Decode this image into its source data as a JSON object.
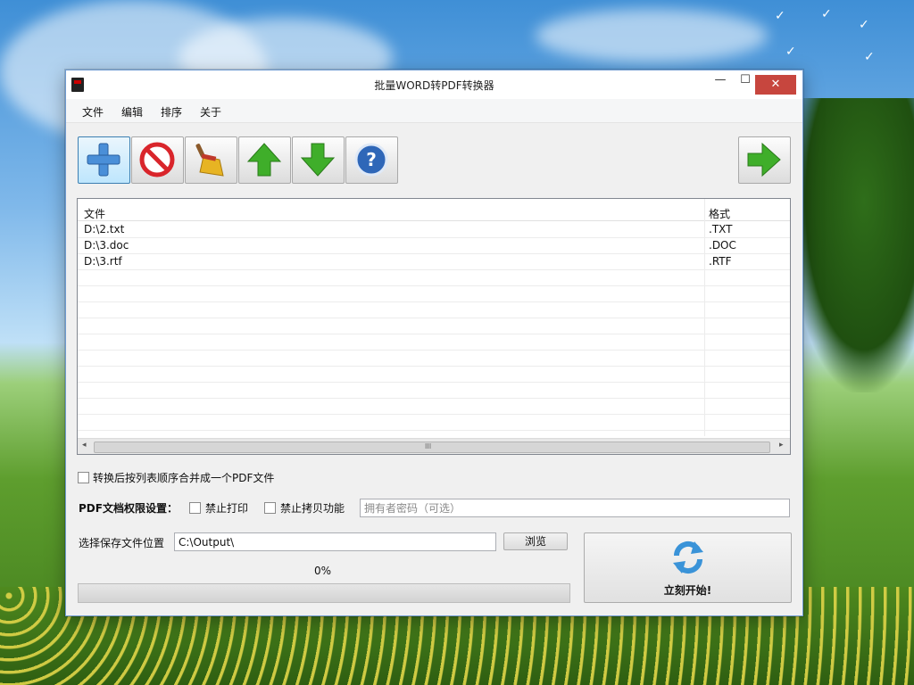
{
  "window": {
    "title": "批量WORD转PDF转换器",
    "controls": {
      "minimize": "—",
      "maximize": "☐",
      "close": "✕"
    }
  },
  "menu": [
    "文件",
    "编辑",
    "排序",
    "关于"
  ],
  "toolbar": {
    "buttons": [
      {
        "icon": "plus-icon"
      },
      {
        "icon": "stop-icon"
      },
      {
        "icon": "broom-icon"
      },
      {
        "icon": "arrow-up-icon"
      },
      {
        "icon": "arrow-down-icon"
      },
      {
        "icon": "help-icon"
      },
      {
        "icon": "arrow-right-icon"
      }
    ],
    "colors": {
      "plus": "#4a8fd8",
      "stop": "#d9252b",
      "green": "#3fae2a",
      "help": "#2f67b8"
    }
  },
  "file_list": {
    "columns": [
      "文件",
      "格式"
    ],
    "rows": [
      {
        "file": "D:\\2.txt",
        "format": ".TXT"
      },
      {
        "file": "D:\\3.doc",
        "format": ".DOC"
      },
      {
        "file": "D:\\3.rtf",
        "format": ".RTF"
      }
    ],
    "scroll_grip": "III",
    "scroll_left": "◂",
    "scroll_right": "▸"
  },
  "merge_option": {
    "label": "转换后按列表顺序合并成一个PDF文件"
  },
  "permissions": {
    "heading": "PDF文档权限设置：",
    "no_print": "禁止打印",
    "no_copy": "禁止拷贝功能",
    "password_placeholder": "拥有者密码（可选）"
  },
  "output": {
    "label": "选择保存文件位置",
    "path": "C:\\Output\\",
    "browse": "浏览"
  },
  "progress": {
    "text": "0%",
    "value": 0
  },
  "start": {
    "label": "立刻开始!"
  }
}
